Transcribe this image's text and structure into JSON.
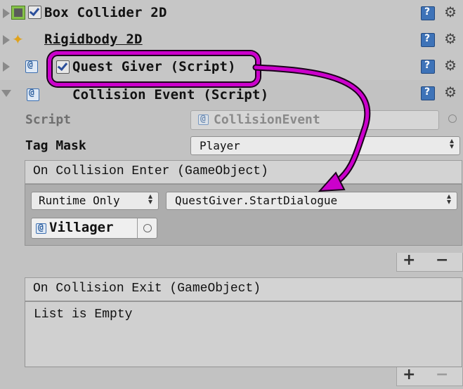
{
  "components": [
    {
      "title": "Box Collider 2D"
    },
    {
      "title": "Rigidbody 2D"
    },
    {
      "title": "Quest Giver (Script)"
    },
    {
      "title": "Collision Event (Script)"
    }
  ],
  "script_field": {
    "label": "Script",
    "value": "CollisionEvent"
  },
  "tag_mask": {
    "label": "Tag Mask",
    "value": "Player"
  },
  "on_enter": {
    "header": "On Collision Enter (GameObject)",
    "runtime": "Runtime Only",
    "function": "QuestGiver.StartDialogue",
    "object": "Villager"
  },
  "on_exit": {
    "header": "On Collision Exit (GameObject)",
    "empty_text": "List is Empty"
  },
  "controls": {
    "plus": "+",
    "minus": "−"
  },
  "colors": {
    "highlight": "#cc00cc",
    "accent": "#3e73b8"
  }
}
